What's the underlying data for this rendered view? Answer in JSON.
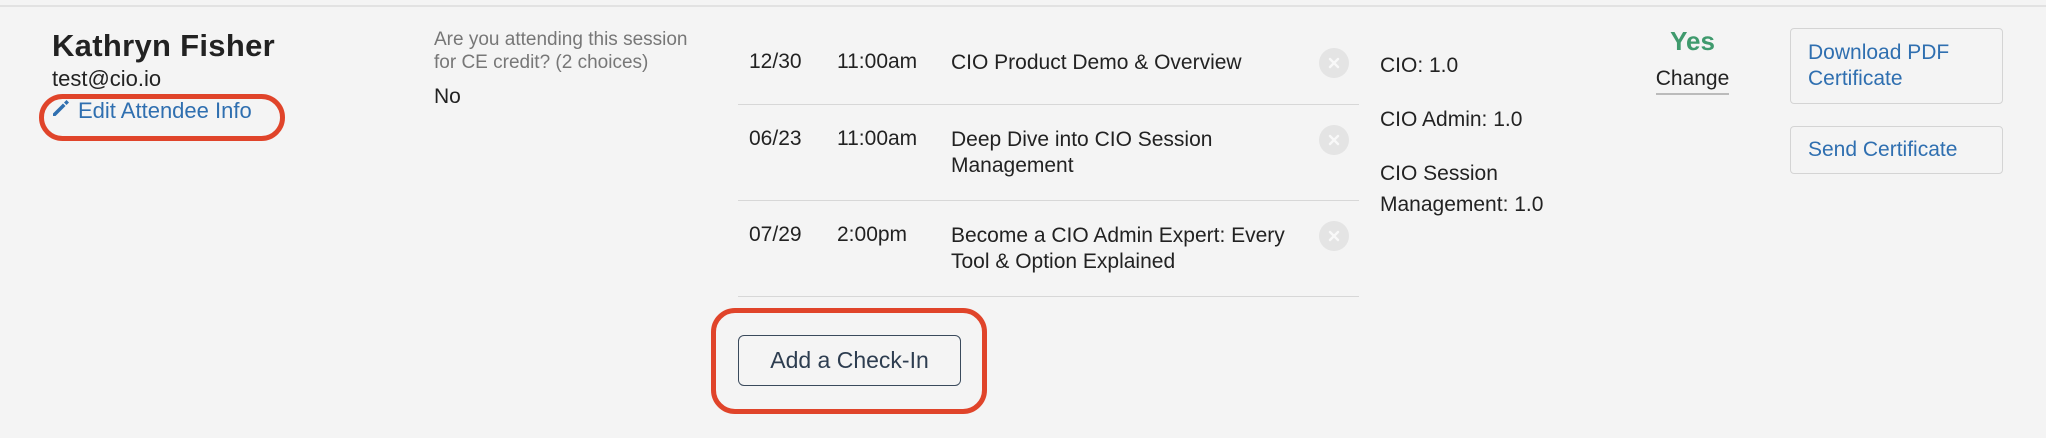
{
  "attendee": {
    "name": "Kathryn Fisher",
    "email": "test@cio.io",
    "edit_label": "Edit Attendee Info"
  },
  "question": {
    "text": "Are you attending this session for CE credit? (2 choices)",
    "answer": "No"
  },
  "sessions": [
    {
      "date": "12/30",
      "time": "11:00am",
      "title": "CIO Product Demo & Overview"
    },
    {
      "date": "06/23",
      "time": "11:00am",
      "title": "Deep Dive into CIO Session Management"
    },
    {
      "date": "07/29",
      "time": "2:00pm",
      "title": "Become a CIO Admin Expert: Every Tool & Option Explained"
    }
  ],
  "add_checkin_label": "Add a Check-In",
  "credits": [
    "CIO: 1.0",
    "CIO Admin: 1.0",
    "CIO Session Management: 1.0"
  ],
  "status": {
    "value": "Yes",
    "change_label": "Change"
  },
  "actions": {
    "download_label": "Download PDF Certificate",
    "send_label": "Send Certificate"
  },
  "colors": {
    "link": "#2f6fb0",
    "status_yes": "#3f9a6d",
    "highlight": "#e0442a"
  },
  "icons": {
    "edit": "pencil-icon",
    "remove": "close-circle-icon"
  }
}
